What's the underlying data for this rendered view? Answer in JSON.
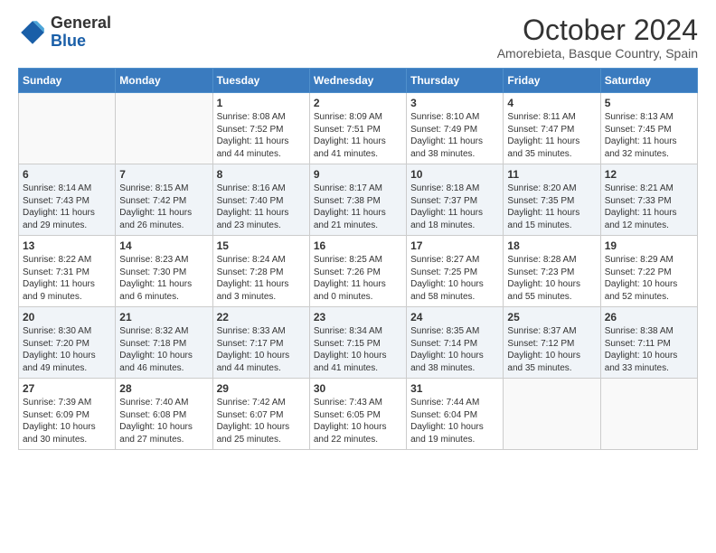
{
  "header": {
    "logo_general": "General",
    "logo_blue": "Blue",
    "month": "October 2024",
    "location": "Amorebieta, Basque Country, Spain"
  },
  "days_of_week": [
    "Sunday",
    "Monday",
    "Tuesday",
    "Wednesday",
    "Thursday",
    "Friday",
    "Saturday"
  ],
  "weeks": [
    [
      {
        "day": "",
        "content": ""
      },
      {
        "day": "",
        "content": ""
      },
      {
        "day": "1",
        "content": "Sunrise: 8:08 AM\nSunset: 7:52 PM\nDaylight: 11 hours and 44 minutes."
      },
      {
        "day": "2",
        "content": "Sunrise: 8:09 AM\nSunset: 7:51 PM\nDaylight: 11 hours and 41 minutes."
      },
      {
        "day": "3",
        "content": "Sunrise: 8:10 AM\nSunset: 7:49 PM\nDaylight: 11 hours and 38 minutes."
      },
      {
        "day": "4",
        "content": "Sunrise: 8:11 AM\nSunset: 7:47 PM\nDaylight: 11 hours and 35 minutes."
      },
      {
        "day": "5",
        "content": "Sunrise: 8:13 AM\nSunset: 7:45 PM\nDaylight: 11 hours and 32 minutes."
      }
    ],
    [
      {
        "day": "6",
        "content": "Sunrise: 8:14 AM\nSunset: 7:43 PM\nDaylight: 11 hours and 29 minutes."
      },
      {
        "day": "7",
        "content": "Sunrise: 8:15 AM\nSunset: 7:42 PM\nDaylight: 11 hours and 26 minutes."
      },
      {
        "day": "8",
        "content": "Sunrise: 8:16 AM\nSunset: 7:40 PM\nDaylight: 11 hours and 23 minutes."
      },
      {
        "day": "9",
        "content": "Sunrise: 8:17 AM\nSunset: 7:38 PM\nDaylight: 11 hours and 21 minutes."
      },
      {
        "day": "10",
        "content": "Sunrise: 8:18 AM\nSunset: 7:37 PM\nDaylight: 11 hours and 18 minutes."
      },
      {
        "day": "11",
        "content": "Sunrise: 8:20 AM\nSunset: 7:35 PM\nDaylight: 11 hours and 15 minutes."
      },
      {
        "day": "12",
        "content": "Sunrise: 8:21 AM\nSunset: 7:33 PM\nDaylight: 11 hours and 12 minutes."
      }
    ],
    [
      {
        "day": "13",
        "content": "Sunrise: 8:22 AM\nSunset: 7:31 PM\nDaylight: 11 hours and 9 minutes."
      },
      {
        "day": "14",
        "content": "Sunrise: 8:23 AM\nSunset: 7:30 PM\nDaylight: 11 hours and 6 minutes."
      },
      {
        "day": "15",
        "content": "Sunrise: 8:24 AM\nSunset: 7:28 PM\nDaylight: 11 hours and 3 minutes."
      },
      {
        "day": "16",
        "content": "Sunrise: 8:25 AM\nSunset: 7:26 PM\nDaylight: 11 hours and 0 minutes."
      },
      {
        "day": "17",
        "content": "Sunrise: 8:27 AM\nSunset: 7:25 PM\nDaylight: 10 hours and 58 minutes."
      },
      {
        "day": "18",
        "content": "Sunrise: 8:28 AM\nSunset: 7:23 PM\nDaylight: 10 hours and 55 minutes."
      },
      {
        "day": "19",
        "content": "Sunrise: 8:29 AM\nSunset: 7:22 PM\nDaylight: 10 hours and 52 minutes."
      }
    ],
    [
      {
        "day": "20",
        "content": "Sunrise: 8:30 AM\nSunset: 7:20 PM\nDaylight: 10 hours and 49 minutes."
      },
      {
        "day": "21",
        "content": "Sunrise: 8:32 AM\nSunset: 7:18 PM\nDaylight: 10 hours and 46 minutes."
      },
      {
        "day": "22",
        "content": "Sunrise: 8:33 AM\nSunset: 7:17 PM\nDaylight: 10 hours and 44 minutes."
      },
      {
        "day": "23",
        "content": "Sunrise: 8:34 AM\nSunset: 7:15 PM\nDaylight: 10 hours and 41 minutes."
      },
      {
        "day": "24",
        "content": "Sunrise: 8:35 AM\nSunset: 7:14 PM\nDaylight: 10 hours and 38 minutes."
      },
      {
        "day": "25",
        "content": "Sunrise: 8:37 AM\nSunset: 7:12 PM\nDaylight: 10 hours and 35 minutes."
      },
      {
        "day": "26",
        "content": "Sunrise: 8:38 AM\nSunset: 7:11 PM\nDaylight: 10 hours and 33 minutes."
      }
    ],
    [
      {
        "day": "27",
        "content": "Sunrise: 7:39 AM\nSunset: 6:09 PM\nDaylight: 10 hours and 30 minutes."
      },
      {
        "day": "28",
        "content": "Sunrise: 7:40 AM\nSunset: 6:08 PM\nDaylight: 10 hours and 27 minutes."
      },
      {
        "day": "29",
        "content": "Sunrise: 7:42 AM\nSunset: 6:07 PM\nDaylight: 10 hours and 25 minutes."
      },
      {
        "day": "30",
        "content": "Sunrise: 7:43 AM\nSunset: 6:05 PM\nDaylight: 10 hours and 22 minutes."
      },
      {
        "day": "31",
        "content": "Sunrise: 7:44 AM\nSunset: 6:04 PM\nDaylight: 10 hours and 19 minutes."
      },
      {
        "day": "",
        "content": ""
      },
      {
        "day": "",
        "content": ""
      }
    ]
  ]
}
